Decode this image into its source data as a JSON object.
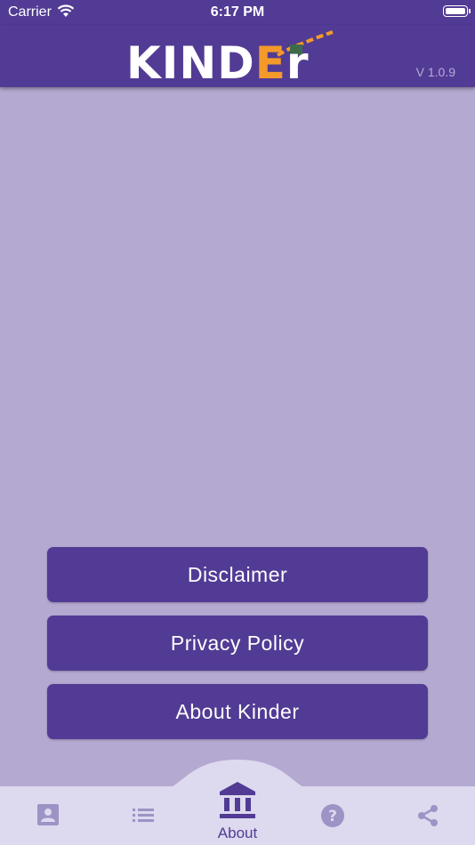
{
  "status_bar": {
    "carrier": "Carrier",
    "time": "6:17 PM"
  },
  "header": {
    "logo": "KINDEr",
    "version": "V 1.0.9"
  },
  "menu": {
    "disclaimer": "Disclaimer",
    "privacy_policy": "Privacy Policy",
    "about_kinder": "About Kinder"
  },
  "tabbar": {
    "items": [
      {
        "icon": "contact-card-icon",
        "active": false
      },
      {
        "icon": "list-icon",
        "active": false
      },
      {
        "icon": "bank-icon",
        "label": "About",
        "active": true
      },
      {
        "icon": "help-icon",
        "active": false
      },
      {
        "icon": "share-icon",
        "active": false
      }
    ]
  },
  "colors": {
    "primary": "#523b94",
    "background": "#b4a9d1",
    "tabbar": "#ddd9ef",
    "inactive_icon": "#9d93c4",
    "logo_accent": "#f39a2b"
  }
}
